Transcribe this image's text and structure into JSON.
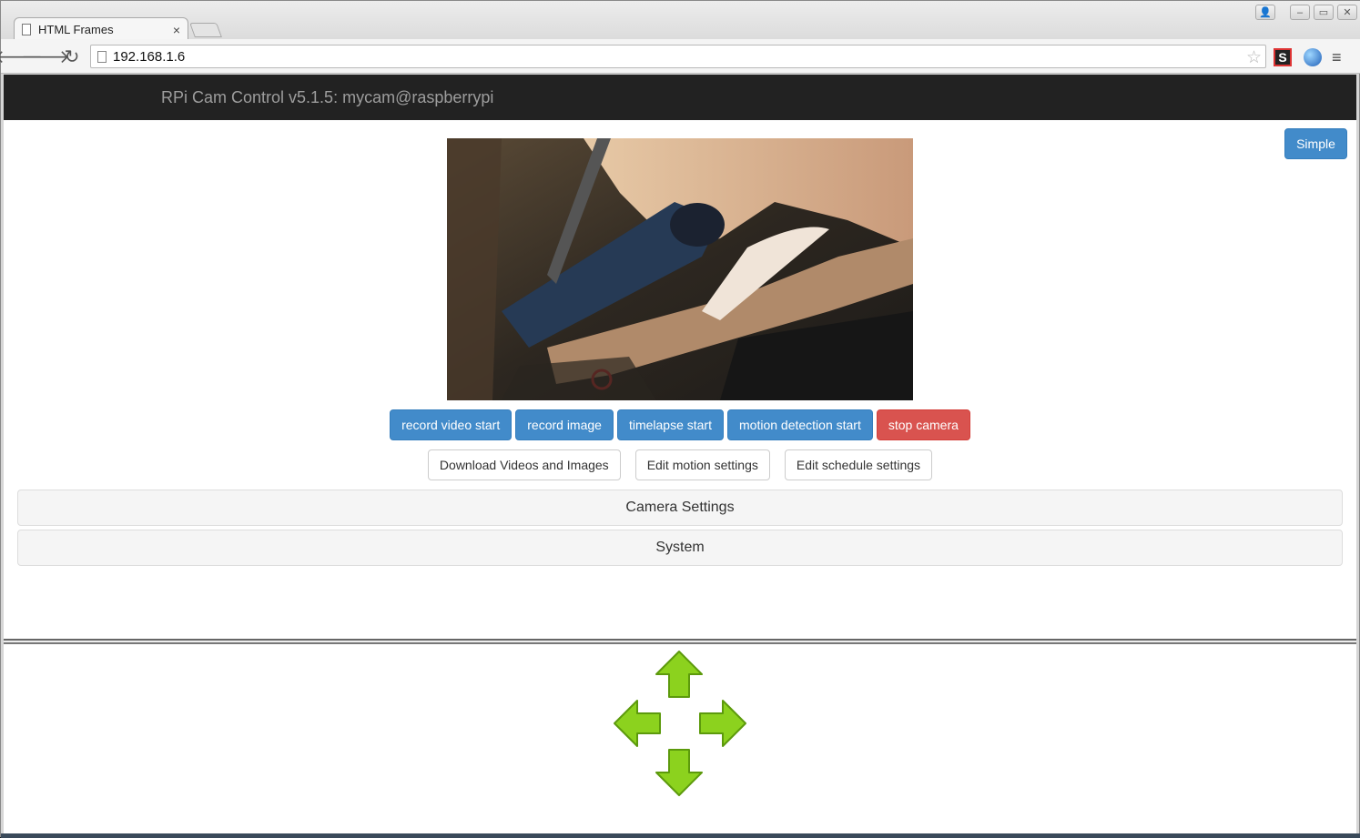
{
  "browser": {
    "tab_title": "HTML Frames",
    "tab_close": "×",
    "url": "192.168.1.6",
    "nav_back": "🡐",
    "nav_forward": "🡒",
    "nav_reload": "↻",
    "star": "☆",
    "menu": "≡",
    "ext_s_label": "S",
    "window_buttons": [
      "👤",
      "–",
      "▭",
      "✕"
    ]
  },
  "navbar": {
    "brand": "RPi Cam Control v5.1.5: mycam@raspberrypi"
  },
  "toolbar": {
    "simple_label": "Simple"
  },
  "controls": {
    "primary_buttons": [
      {
        "label": "record video start",
        "style": "primary"
      },
      {
        "label": "record image",
        "style": "primary"
      },
      {
        "label": "timelapse start",
        "style": "primary"
      },
      {
        "label": "motion detection start",
        "style": "primary"
      },
      {
        "label": "stop camera",
        "style": "danger"
      }
    ],
    "secondary_buttons": [
      {
        "label": "Download Videos and Images"
      },
      {
        "label": "Edit motion settings"
      },
      {
        "label": "Edit schedule settings"
      }
    ]
  },
  "panels": {
    "camera_settings": "Camera Settings",
    "system": "System"
  },
  "pan_tilt": {
    "icons": [
      "arrow-up-icon",
      "arrow-left-icon",
      "arrow-right-icon",
      "arrow-down-icon"
    ],
    "color": "#8cd21e"
  },
  "colors": {
    "primary": "#428bca",
    "danger": "#d9534f",
    "navbar": "#222222"
  }
}
